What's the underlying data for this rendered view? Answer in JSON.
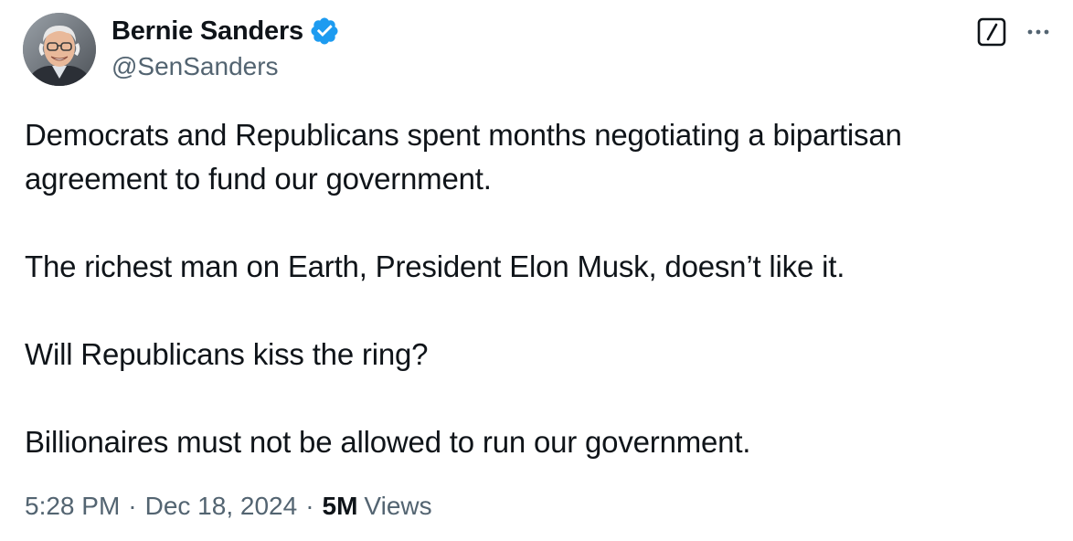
{
  "author": {
    "display_name": "Bernie Sanders",
    "handle": "@SenSanders",
    "verified": true,
    "verified_color": "#1d9bf0"
  },
  "tweet": {
    "paragraphs": [
      "Democrats and Republicans spent months negotiating a bipartisan agreement to fund our government.",
      "The richest man on Earth, President Elon Musk, doesn’t like it.",
      "Will Republicans kiss the ring?",
      "Billionaires must not be allowed to run our government."
    ]
  },
  "meta": {
    "time": "5:28 PM",
    "date": "Dec 18, 2024",
    "separator": "·",
    "views_count": "5M",
    "views_label": "Views"
  },
  "icons": {
    "verified": "verified-badge-icon",
    "grok": "grok-icon",
    "more": "more-options-icon"
  },
  "colors": {
    "text_primary": "#0f1419",
    "text_secondary": "#536471",
    "background": "#ffffff"
  }
}
